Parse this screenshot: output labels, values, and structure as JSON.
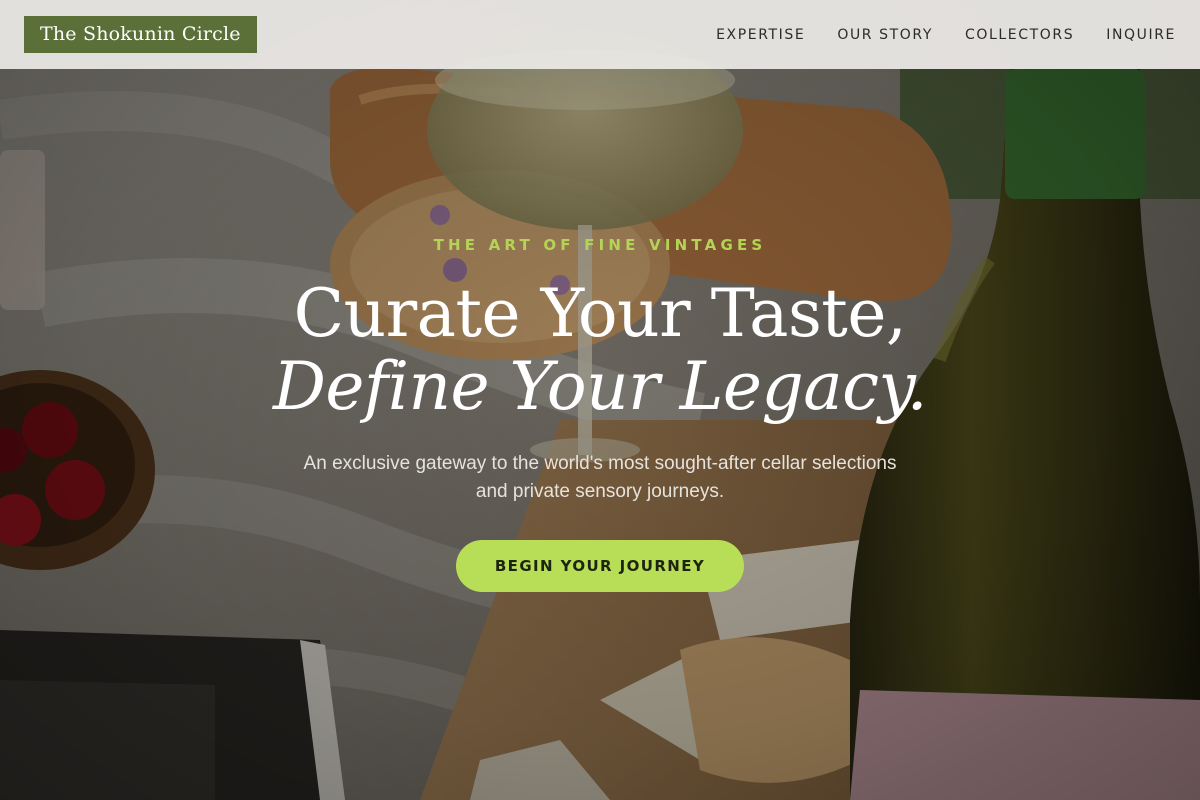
{
  "header": {
    "brand": "The Shokunin Circle",
    "nav": [
      {
        "label": "EXPERTISE"
      },
      {
        "label": "OUR STORY"
      },
      {
        "label": "COLLECTORS"
      },
      {
        "label": "INQUIRE"
      }
    ]
  },
  "hero": {
    "eyebrow": "THE ART OF FINE VINTAGES",
    "title_line1": "Curate Your Taste,",
    "title_line2": "Define Your Legacy.",
    "subtitle": "An exclusive gateway to the world's most sought-after cellar selections and private sensory journeys.",
    "cta_label": "BEGIN YOUR JOURNEY"
  },
  "colors": {
    "brand_green": "#5b7038",
    "accent_lime": "#b8dd56",
    "eyebrow_lime": "#b5d356",
    "header_bg": "#eeece8"
  }
}
